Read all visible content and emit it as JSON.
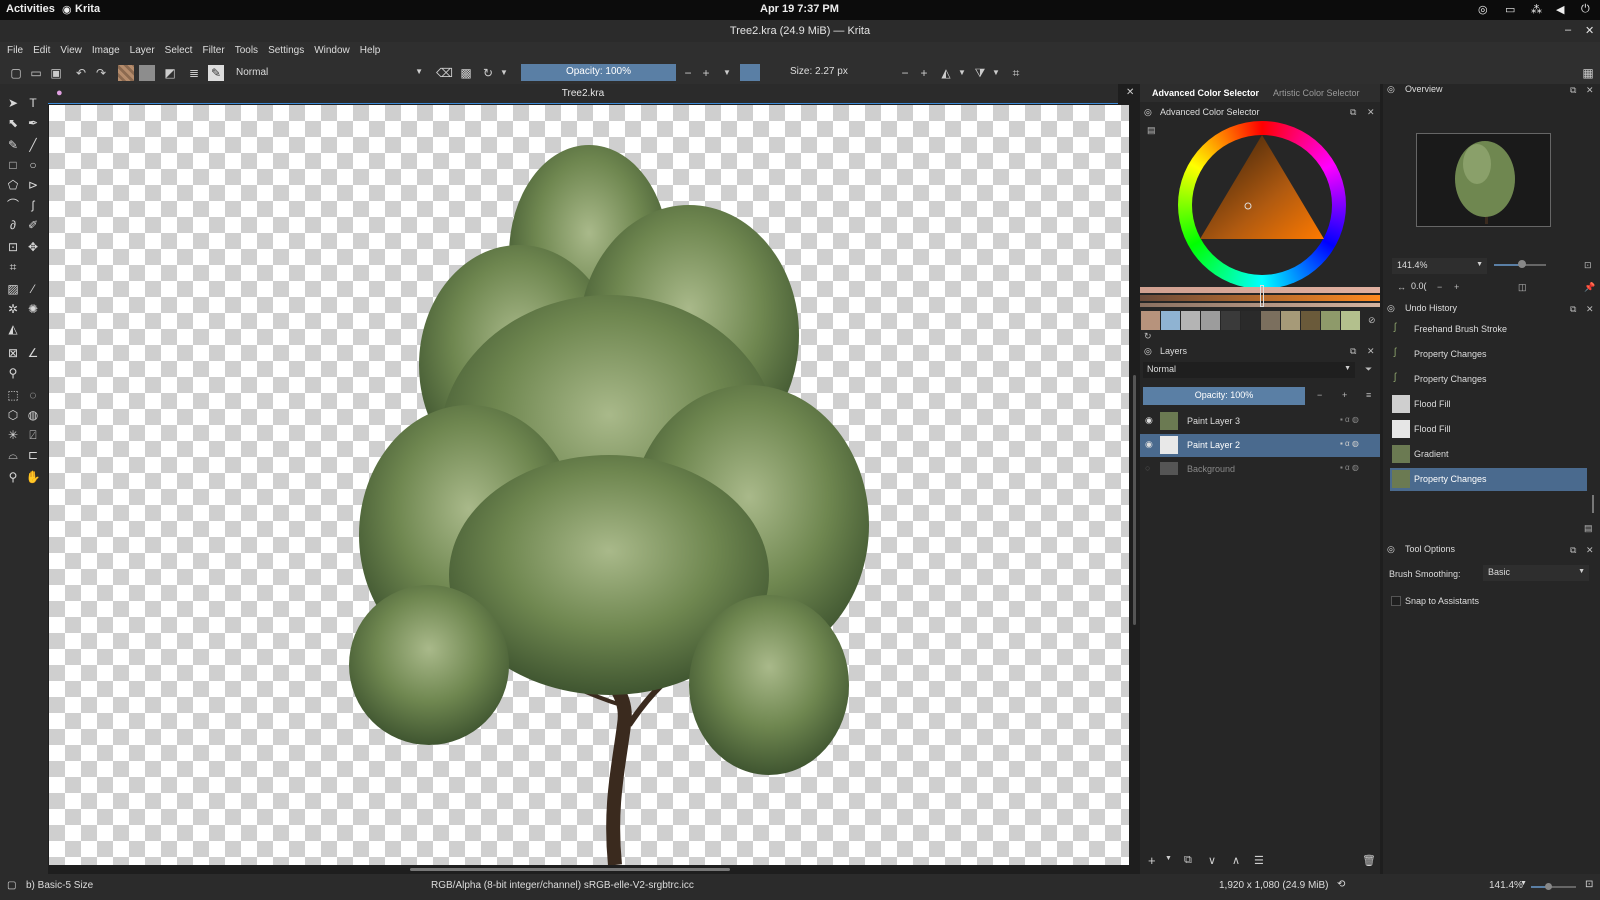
{
  "system": {
    "activities": "Activities",
    "app": "Krita",
    "clock": "Apr 19  7:37 PM"
  },
  "window": {
    "title": "Tree2.kra (24.9 MiB) — Krita"
  },
  "menu": [
    "File",
    "Edit",
    "View",
    "Image",
    "Layer",
    "Select",
    "Filter",
    "Tools",
    "Settings",
    "Window",
    "Help"
  ],
  "toolbar": {
    "blend_mode": "Normal",
    "opacity": "Opacity: 100%",
    "size": "Size: 2.27 px"
  },
  "canvas": {
    "tab_title": "Tree2.kra"
  },
  "color_panel": {
    "tab_active": "Advanced Color Selector",
    "tab_inactive": "Artistic Color Selector",
    "dock_title": "Advanced Color Selector",
    "swatches": [
      "#b7937c",
      "#8fb3d2",
      "#b4b4b4",
      "#9c9c9c",
      "#3a3a3a",
      "#2a2a2a",
      "#7b6f5e",
      "#a69a78",
      "#6a5a3a",
      "#8e9a6a",
      "#b3c08d"
    ]
  },
  "layers_panel": {
    "dock_title": "Layers",
    "blend_mode": "Normal",
    "opacity": "Opacity: 100%",
    "layers": [
      {
        "name": "Paint Layer 3",
        "selected": false,
        "visible": true
      },
      {
        "name": "Paint Layer 2",
        "selected": true,
        "visible": true
      },
      {
        "name": "Background",
        "selected": false,
        "visible": false
      }
    ]
  },
  "overview_panel": {
    "dock_title": "Overview",
    "zoom": "141.4%",
    "rotation": "0.0("
  },
  "undo_panel": {
    "dock_title": "Undo History",
    "items": [
      {
        "label": "Freehand Brush Stroke",
        "selected": false
      },
      {
        "label": "Property Changes",
        "selected": false
      },
      {
        "label": "Property Changes",
        "selected": false
      },
      {
        "label": "Flood Fill",
        "selected": false
      },
      {
        "label": "Flood Fill",
        "selected": false
      },
      {
        "label": "Gradient",
        "selected": false
      },
      {
        "label": "Property Changes",
        "selected": true
      }
    ]
  },
  "tool_options": {
    "dock_title": "Tool Options",
    "brush_smoothing_label": "Brush Smoothing:",
    "brush_smoothing_value": "Basic",
    "snap_label": "Snap to Assistants"
  },
  "status": {
    "brush": "b) Basic-5 Size",
    "color_space": "RGB/Alpha (8-bit integer/channel)  sRGB-elle-V2-srgbtrc.icc",
    "image_size": "1,920 x 1,080 (24.9 MiB)",
    "zoom": "141.4%"
  },
  "colors": {
    "accent": "#5a7fa5",
    "selection": "#4a6a8e"
  }
}
